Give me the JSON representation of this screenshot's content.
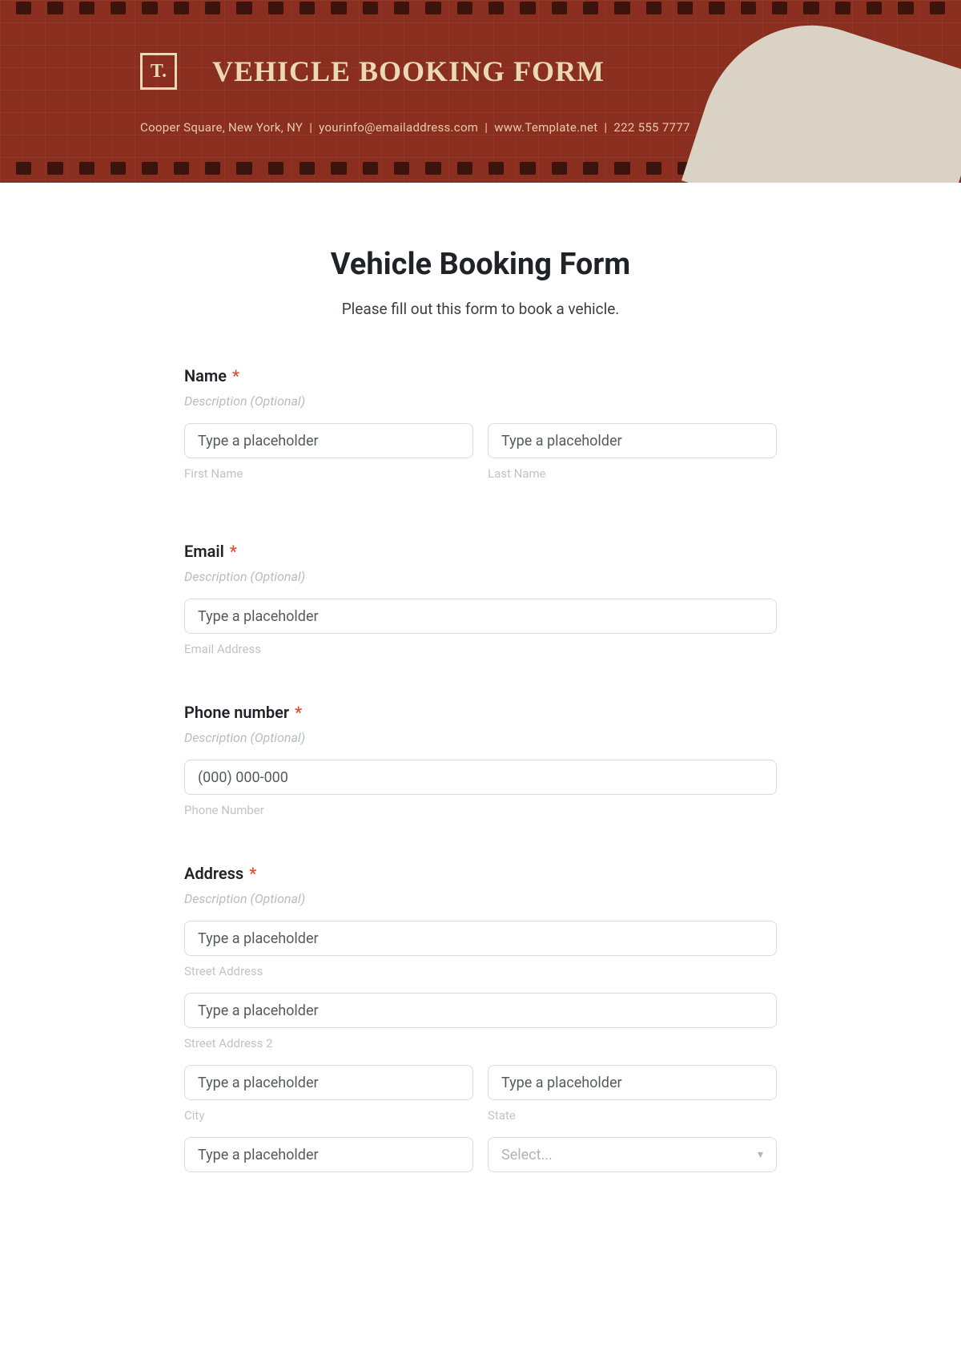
{
  "banner": {
    "logo_text": "T.",
    "title": "VEHICLE BOOKING FORM",
    "address": "Cooper Square, New York, NY",
    "email": "yourinfo@emailaddress.com",
    "website": "www.Template.net",
    "phone": "222 555 7777"
  },
  "form": {
    "title": "Vehicle Booking Form",
    "description": "Please fill out this form to book a vehicle.",
    "required_mark": "*",
    "hint_text": "Description (Optional)",
    "name": {
      "label": "Name",
      "first_placeholder": "Type a placeholder",
      "first_sublabel": "First Name",
      "last_placeholder": "Type a placeholder",
      "last_sublabel": "Last Name"
    },
    "email_field": {
      "label": "Email",
      "placeholder": "Type a placeholder",
      "sublabel": "Email Address"
    },
    "phone_field": {
      "label": "Phone number",
      "placeholder": "(000) 000-000",
      "sublabel": "Phone Number"
    },
    "address": {
      "label": "Address",
      "street_placeholder": "Type a placeholder",
      "street_sublabel": "Street Address",
      "street2_placeholder": "Type a placeholder",
      "street2_sublabel": "Street Address 2",
      "city_placeholder": "Type a placeholder",
      "city_sublabel": "City",
      "state_placeholder": "Type a placeholder",
      "state_sublabel": "State",
      "zip_placeholder": "Type a placeholder",
      "country_select": "Select..."
    }
  }
}
